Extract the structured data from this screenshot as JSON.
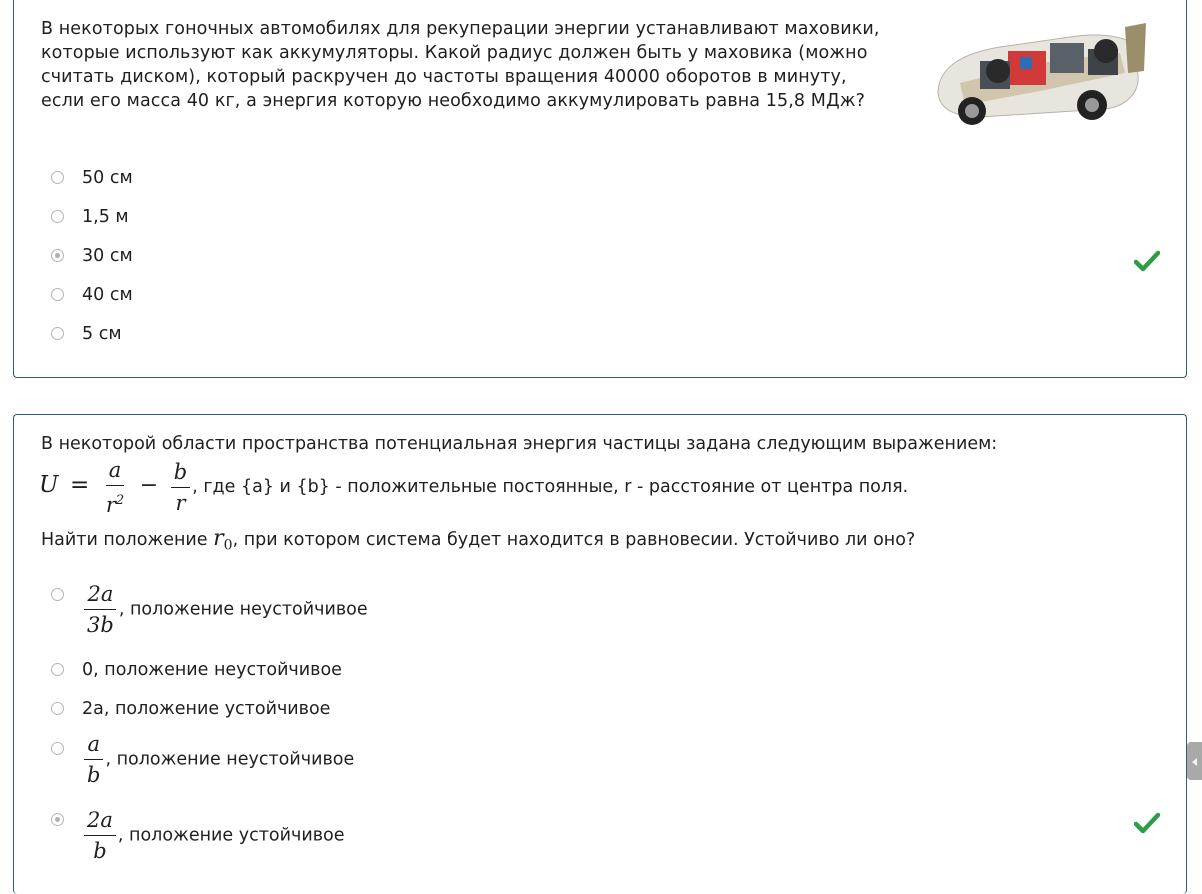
{
  "question1": {
    "text": "В некоторых гоночных автомобилях для рекуперации энергии устанавливают маховики, которые используют как аккумуляторы. Какой радиус должен быть у маховика (можно считать диском), который раскручен до частоты вращения 40000 оборотов в минуту, если его масса 40 кг, а энергия которую необходимо аккумулировать равна 15,8 МДж?",
    "image_alt": "race car cutaway",
    "options": [
      {
        "label": "50 см",
        "selected": false
      },
      {
        "label": "1,5 м",
        "selected": false
      },
      {
        "label": "30 см",
        "selected": true,
        "correct": true
      },
      {
        "label": "40 см",
        "selected": false
      },
      {
        "label": "5 см",
        "selected": false
      }
    ]
  },
  "question2": {
    "line1": "В некоторой области пространства потенциальная энергия частицы задана следующим выражением:",
    "formula": {
      "lhs": "U",
      "eq": "=",
      "f1_num": "a",
      "f1_den": "r",
      "f1_den_exp": "2",
      "minus": "−",
      "f2_num": "b",
      "f2_den": "r"
    },
    "formula_tail": ", где {a} и {b} - положительные постоянные, r - расстояние от центра поля.",
    "line3_a": "Найти положение ",
    "line3_var": "r",
    "line3_sub": "0",
    "line3_b": ", при котором система будет находится в равновесии. Устойчиво ли оно?",
    "options": [
      {
        "num": "2a",
        "den": "3b",
        "text": ", положение неустойчивое",
        "selected": false
      },
      {
        "text": "0, положение неустойчивое",
        "selected": false
      },
      {
        "text": "2a, положение устойчивое",
        "selected": false
      },
      {
        "num": "a",
        "den": "b",
        "text": ", положение неустойчивое",
        "selected": false
      },
      {
        "num": "2a",
        "den": "b",
        "text": ", положение устойчивое",
        "selected": true,
        "correct": true
      }
    ]
  },
  "colors": {
    "border": "#2f5f6a",
    "check": "#2e9e45",
    "radio": "#b5b5b5"
  },
  "icons": {
    "correct": "checkmark-icon",
    "scroll": "chevron-left-icon"
  }
}
